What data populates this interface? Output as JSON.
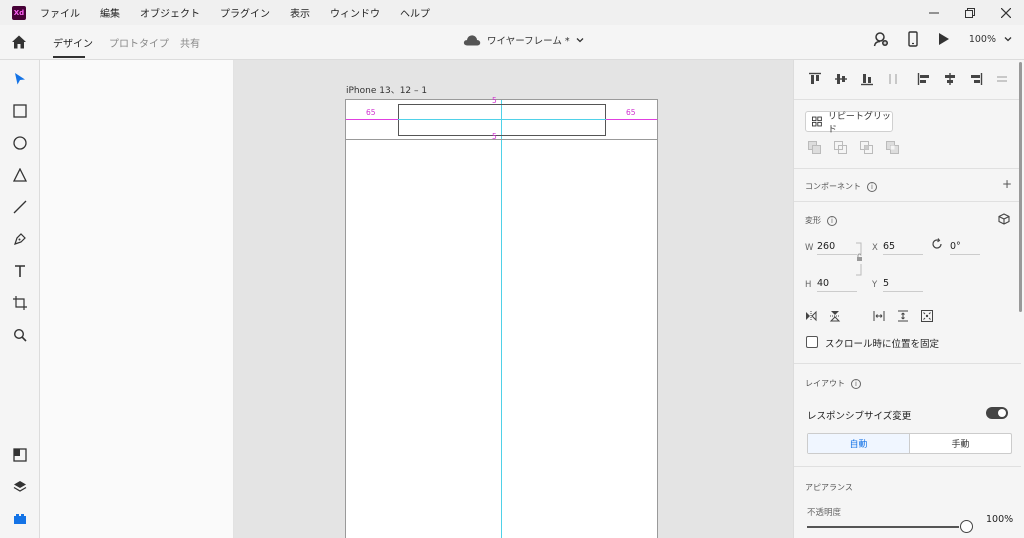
{
  "app": {
    "logo_text": "Xd"
  },
  "menu": [
    "ファイル",
    "編集",
    "オブジェクト",
    "プラグイン",
    "表示",
    "ウィンドウ",
    "ヘルプ"
  ],
  "mode_tabs": {
    "design": "デザイン",
    "prototype": "プロトタイプ",
    "share": "共有"
  },
  "document": {
    "title": "ワイヤーフレーム *"
  },
  "toolbar": {
    "zoom": "100%"
  },
  "canvas": {
    "artboard_name": "iPhone 13、12 – 1",
    "measure_left": "65",
    "measure_right": "65",
    "measure_top": "5",
    "measure_bottom": "5"
  },
  "properties": {
    "repeat_grid_label": "リピートグリッド",
    "components_title": "コンポーネント",
    "transform_title": "変形",
    "w_label": "W",
    "w_value": "260",
    "x_label": "X",
    "x_value": "65",
    "h_label": "H",
    "h_value": "40",
    "y_label": "Y",
    "y_value": "5",
    "rotation_value": "0°",
    "fix_scroll_label": "スクロール時に位置を固定",
    "layout_title": "レイアウト",
    "responsive_label": "レスポンシブサイズ変更",
    "responsive_on": true,
    "auto_label": "自動",
    "manual_label": "手動",
    "appearance_title": "アピアランス",
    "opacity_label": "不透明度",
    "opacity_value": "100%"
  },
  "colors": {
    "accent": "#1473e6",
    "guide": "#4fd1e8",
    "measure": "#d030d0",
    "xd_bg": "#470137",
    "xd_fg": "#ff61f6"
  }
}
